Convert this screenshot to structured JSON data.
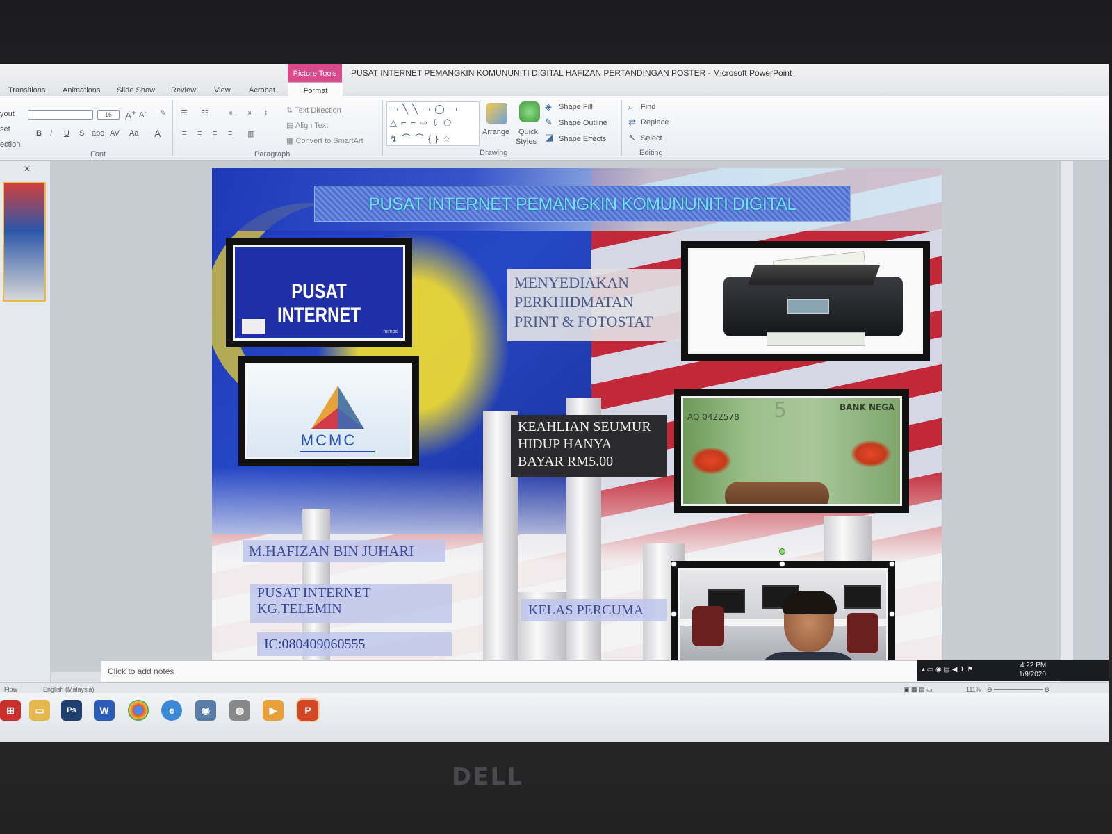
{
  "window": {
    "title": "PUSAT INTERNET PEMANGKIN KOMUNUNITI DIGITAL HAFIZAN PERTANDINGAN POSTER  -  Microsoft PowerPoint",
    "context_tab_group": "Picture Tools"
  },
  "tabs": [
    "Transitions",
    "Animations",
    "Slide Show",
    "Review",
    "View",
    "Acrobat",
    "Format"
  ],
  "active_tab": "Format",
  "ribbon": {
    "left_clipped": [
      "yout",
      "set",
      "ection"
    ],
    "font_size": "16",
    "font_group_label": "Font",
    "paragraph": {
      "text_direction": "Text Direction",
      "align_text": "Align Text",
      "convert_smartart": "Convert to SmartArt",
      "label": "Paragraph"
    },
    "drawing": {
      "arrange": "Arrange",
      "quick_styles_1": "Quick",
      "quick_styles_2": "Styles",
      "shape_fill": "Shape Fill",
      "shape_outline": "Shape Outline",
      "shape_effects": "Shape Effects",
      "label": "Drawing"
    },
    "editing": {
      "find": "Find",
      "replace": "Replace",
      "select": "Select",
      "label": "Editing"
    }
  },
  "slide": {
    "banner": "PUSAT INTERNET PEMANGKIN KOMUNUNITI DIGITAL",
    "pusat_internet_logo": "PUSAT INTERNET",
    "pusat_tag": "mimps",
    "mcmc_logo": "MCMC",
    "service_lines": [
      "MENYEDIAKAN",
      "PERKHIDMATAN",
      "PRINT & FOTOSTAT"
    ],
    "membership_lines": [
      "KEAHLIAN SEUMUR",
      "HIDUP HANYA",
      "BAYAR RM5.00"
    ],
    "money_serial": "AQ 0422578",
    "money_bank": "BANK NEGA",
    "money_number": "5",
    "name": "M.HAFIZAN BIN JUHARI",
    "centre_lines": [
      "PUSAT INTERNET",
      "KG.TELEMIN"
    ],
    "ic": "IC:080409060555",
    "free_class": "KELAS PERCUMA"
  },
  "notes_placeholder": "Click to add notes",
  "status": {
    "theme": "Flow",
    "language": "English (Malaysia)",
    "zoom": "111%"
  },
  "tray": {
    "time": "4:22 PM",
    "date": "1/9/2020"
  },
  "taskbar_apps": [
    "start",
    "explorer",
    "photoshop",
    "word",
    "chrome",
    "internet-explorer",
    "network",
    "media",
    "powerpoint"
  ],
  "colors": {
    "picture_tools": "#d84a8c",
    "slide_blue": "#2a3fa4",
    "flag_red": "#d3262c",
    "banner_text": "#6fe3f2"
  },
  "brand": "DELL"
}
